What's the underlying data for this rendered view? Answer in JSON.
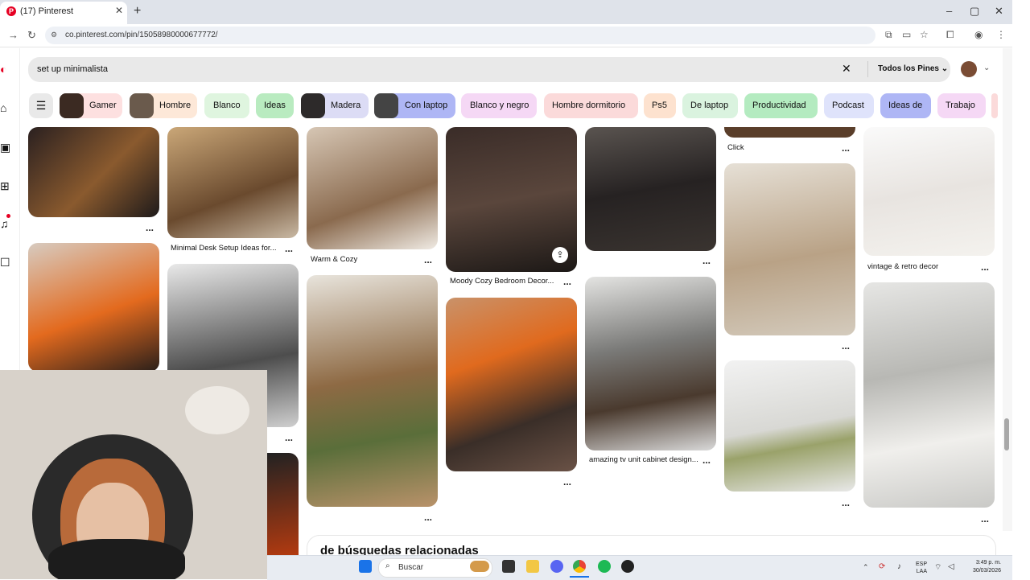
{
  "browser": {
    "tab_title": "(17) Pinterest",
    "tab_icon": "P",
    "tab_close": "✕",
    "new_tab": "+",
    "url": "co.pinterest.com/pin/15058980000677772/",
    "window": {
      "minimize": "–",
      "maximize": "▢",
      "close": "✕"
    }
  },
  "search": {
    "query": "set up minimalista",
    "filter_label": "Todos los Pines ⌄",
    "clear": "✕"
  },
  "chips": [
    {
      "label": "Gamer",
      "color": "#fde0e0"
    },
    {
      "label": "Hombre",
      "color": "#fde8d8"
    },
    {
      "label": "Blanco",
      "color": "#dff5df"
    },
    {
      "label": "Ideas",
      "color": "#b9ebc0"
    },
    {
      "label": "Madera",
      "color": "#dcdcf5"
    },
    {
      "label": "Con laptop",
      "color": "#aeb6f5"
    },
    {
      "label": "Blanco y negro",
      "color": "#f5d8f5"
    },
    {
      "label": "Hombre dormitorio",
      "color": "#fbdada"
    },
    {
      "label": "Ps5",
      "color": "#fde2cf"
    },
    {
      "label": "De laptop",
      "color": "#daf3df"
    },
    {
      "label": "Productividad",
      "color": "#b4ebc0"
    },
    {
      "label": "Podcast",
      "color": "#dfe3fb"
    },
    {
      "label": "Ideas de",
      "color": "#aeb6f5"
    },
    {
      "label": "Trabajo",
      "color": "#f5d8f5"
    }
  ],
  "pins": {
    "minimal_desk": "Minimal Desk Setup Ideas for...",
    "warm_cozy": "Warm & Cozy",
    "moody_cozy": "Moody Cozy Bedroom Decor...",
    "click": "Click",
    "vintage_retro": "vintage & retro decor",
    "amazing_tv": "amazing tv unit cabinet design...",
    "more": "..."
  },
  "related": {
    "title": "de búsquedas relacionadas"
  },
  "taskbar": {
    "search_placeholder": "Buscar",
    "lang": "ESP\nLAA",
    "time": "3:49 p. m.",
    "date": "30/03/2026"
  },
  "colors": {
    "pinterest_red": "#e60023",
    "search_bg": "#e9e9e9"
  }
}
